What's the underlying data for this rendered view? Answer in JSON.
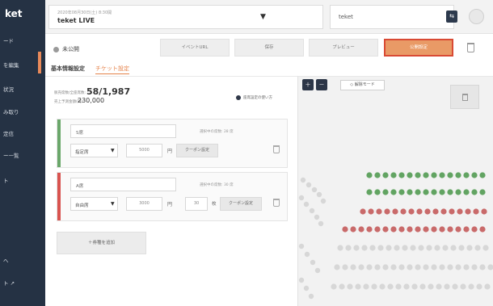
{
  "app": {
    "logo": "ket"
  },
  "sidebar": {
    "items": [
      {
        "label": "ード"
      },
      {
        "label": "を編集"
      },
      {
        "label": "状況"
      },
      {
        "label": "み取り"
      },
      {
        "label": "定信"
      },
      {
        "label": "ー一覧"
      },
      {
        "label": "ト"
      },
      {
        "label": "へ"
      },
      {
        "label": "ト  ↗"
      }
    ]
  },
  "header": {
    "event_date": "2020年08月30日(土)  8:30開",
    "event_name": "teket LIVE",
    "org_name": "teket",
    "switch_icon": "⇆"
  },
  "status": {
    "label": "未公開"
  },
  "toolbar": {
    "event_url": "イベントURL",
    "save": "保存",
    "preview": "プレビュー",
    "publish": "公開設定"
  },
  "tabs": {
    "basic": "基本情報設定",
    "ticket": "チケット設定"
  },
  "summary": {
    "seats_label": "販売席数/全座席数:",
    "seats_value": "58/1,987",
    "revenue_label": "売上予測金額(円):",
    "revenue_value": "230,000",
    "help_link": "座席設定の使い方"
  },
  "tickets": [
    {
      "name": "S席",
      "sold": "選択中の席数: 28 席",
      "seat_type": "指定席",
      "price": "5000",
      "yen": "円",
      "coupon": "クーポン設定",
      "accent": "#6aa76a"
    },
    {
      "name": "A席",
      "sold": "選択中の席数: 30 席",
      "seat_type": "自由席",
      "price": "3000",
      "yen": "円",
      "limit": "30",
      "limit_unit": "枚",
      "coupon": "クーポン設定",
      "accent": "#d9534f"
    }
  ],
  "add_ticket": "＋券種を追加",
  "seatmap": {
    "zoom_in": "＋",
    "zoom_out": "－",
    "select_mode": "◇ 解除モード",
    "colors": {
      "green": "#62a462",
      "red": "#c96a6a",
      "empty": "#d7d7d7"
    }
  }
}
